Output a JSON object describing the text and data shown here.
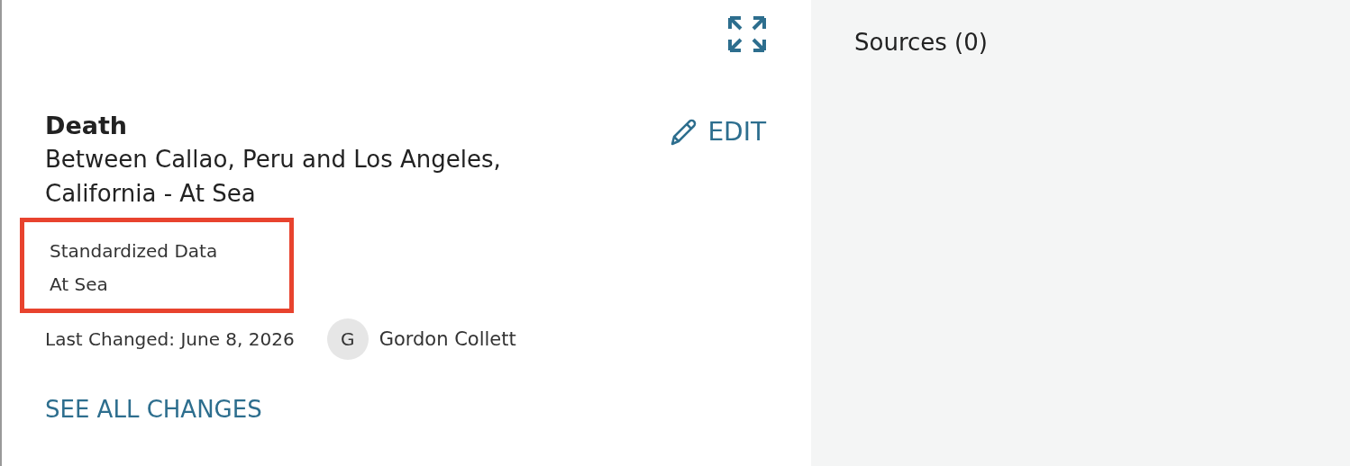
{
  "event": {
    "title": "Death",
    "place": "Between Callao, Peru and Los Angeles, California - At Sea",
    "edit_label": "EDIT"
  },
  "standardized": {
    "label": "Standardized Data",
    "value": "At Sea",
    "highlighted": true
  },
  "change": {
    "last_changed": "Last Changed: June 8, 2026",
    "user_initial": "G",
    "user_name": "Gordon Collett"
  },
  "see_all": "SEE ALL CHANGES",
  "sources": {
    "title": "Sources (0)"
  }
}
